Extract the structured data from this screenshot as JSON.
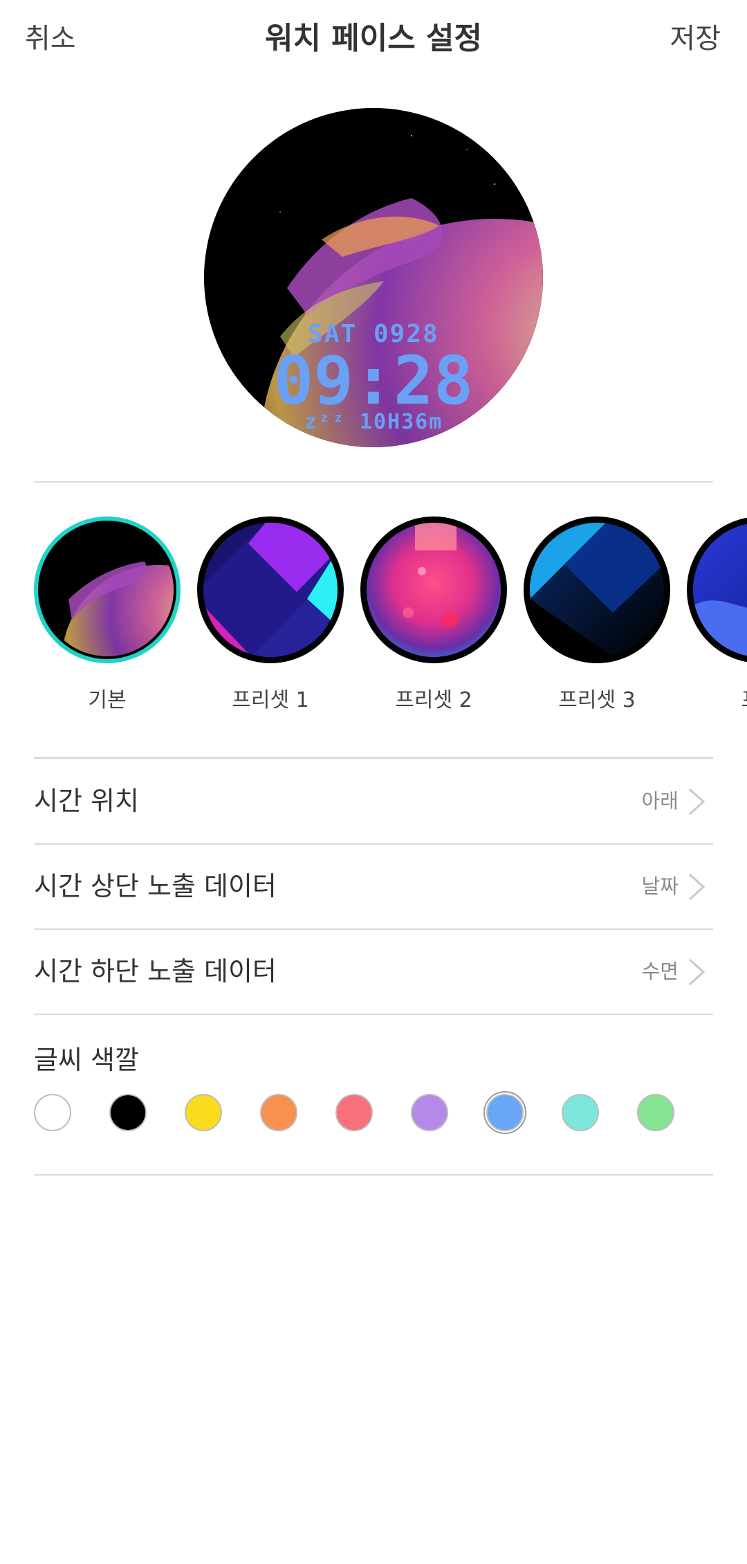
{
  "header": {
    "cancel_label": "취소",
    "title": "워치 페이스 설정",
    "save_label": "저장"
  },
  "watch_face": {
    "date_text": "SAT 0928",
    "time_text": "09:28",
    "sleep_text": "zᶻᶻ 10H36m",
    "text_color": "#6aa0f5"
  },
  "presets": [
    {
      "label": "기본",
      "selected": true,
      "theme": "planet"
    },
    {
      "label": "프리셋 1",
      "selected": false,
      "theme": "purple-geometric"
    },
    {
      "label": "프리셋 2",
      "selected": false,
      "theme": "neon-liquid"
    },
    {
      "label": "프리셋 3",
      "selected": false,
      "theme": "dark-blue-geometric"
    },
    {
      "label": "프리",
      "selected": false,
      "theme": "blue-wave"
    }
  ],
  "settings": [
    {
      "label": "시간 위치",
      "value": "아래"
    },
    {
      "label": "시간 상단 노출 데이터",
      "value": "날짜"
    },
    {
      "label": "시간 하단 노출 데이터",
      "value": "수면"
    }
  ],
  "text_color_section": {
    "title": "글씨 색깔",
    "colors": [
      "#ffffff",
      "#000000",
      "#fadb1e",
      "#f89050",
      "#f7707c",
      "#b589ea",
      "#6aa6f6",
      "#7de6dc",
      "#85e394"
    ],
    "selected_index": 6
  }
}
